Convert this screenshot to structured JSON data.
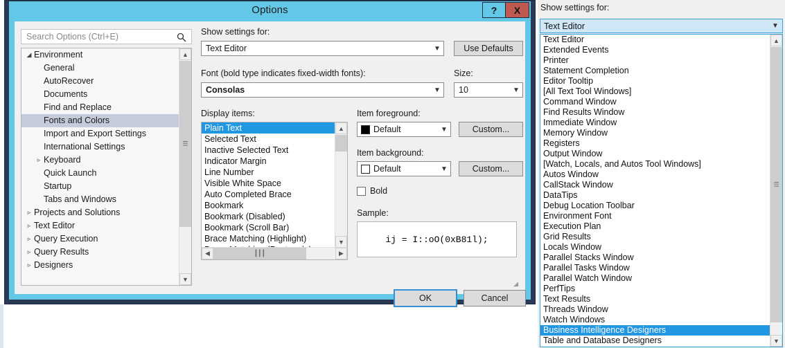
{
  "dialog": {
    "title": "Options",
    "help_button": "?",
    "close_button": "X",
    "search": {
      "placeholder": "Search Options (Ctrl+E)",
      "icon": "search-icon"
    },
    "tree": [
      {
        "label": "Environment",
        "level": 0,
        "expander": "expanded",
        "selected": false
      },
      {
        "label": "General",
        "level": 1,
        "expander": "none",
        "selected": false
      },
      {
        "label": "AutoRecover",
        "level": 1,
        "expander": "none",
        "selected": false
      },
      {
        "label": "Documents",
        "level": 1,
        "expander": "none",
        "selected": false
      },
      {
        "label": "Find and Replace",
        "level": 1,
        "expander": "none",
        "selected": false
      },
      {
        "label": "Fonts and Colors",
        "level": 1,
        "expander": "none",
        "selected": true
      },
      {
        "label": "Import and Export Settings",
        "level": 1,
        "expander": "none",
        "selected": false
      },
      {
        "label": "International Settings",
        "level": 1,
        "expander": "none",
        "selected": false
      },
      {
        "label": "Keyboard",
        "level": 1,
        "expander": "collapsed",
        "selected": false
      },
      {
        "label": "Quick Launch",
        "level": 1,
        "expander": "none",
        "selected": false
      },
      {
        "label": "Startup",
        "level": 1,
        "expander": "none",
        "selected": false
      },
      {
        "label": "Tabs and Windows",
        "level": 1,
        "expander": "none",
        "selected": false
      },
      {
        "label": "Projects and Solutions",
        "level": 0,
        "expander": "collapsed",
        "selected": false
      },
      {
        "label": "Text Editor",
        "level": 0,
        "expander": "collapsed",
        "selected": false
      },
      {
        "label": "Query Execution",
        "level": 0,
        "expander": "collapsed",
        "selected": false
      },
      {
        "label": "Query Results",
        "level": 0,
        "expander": "collapsed",
        "selected": false
      },
      {
        "label": "Designers",
        "level": 0,
        "expander": "collapsed",
        "selected": false
      }
    ],
    "show_settings_label": "Show settings for:",
    "show_settings_value": "Text Editor",
    "use_defaults_label": "Use Defaults",
    "font_label": "Font (bold type indicates fixed-width fonts):",
    "font_value": "Consolas",
    "size_label": "Size:",
    "size_value": "10",
    "display_items_label": "Display items:",
    "display_items": [
      "Plain Text",
      "Selected Text",
      "Inactive Selected Text",
      "Indicator Margin",
      "Line Number",
      "Visible White Space",
      "Auto Completed Brace",
      "Bookmark",
      "Bookmark (Disabled)",
      "Bookmark (Scroll Bar)",
      "Brace Matching (Highlight)",
      "Brace Matching (Rectangle)"
    ],
    "display_items_selected": "Plain Text",
    "item_foreground_label": "Item foreground:",
    "item_foreground_value": "Default",
    "item_foreground_swatch": "#000000",
    "item_foreground_custom": "Custom...",
    "item_background_label": "Item background:",
    "item_background_value": "Default",
    "item_background_swatch": "#ffffff",
    "item_background_custom": "Custom...",
    "bold_label": "Bold",
    "bold_checked": false,
    "sample_label": "Sample:",
    "sample_text": "ij = I::oO(0xB81l);",
    "ok_label": "OK",
    "cancel_label": "Cancel"
  },
  "right_panel": {
    "label": "Show settings for:",
    "selected_value": "Text Editor",
    "items": [
      {
        "label": "Text Editor",
        "selected": false
      },
      {
        "label": "Extended Events",
        "selected": false
      },
      {
        "label": "Printer",
        "selected": false
      },
      {
        "label": "Statement Completion",
        "selected": false
      },
      {
        "label": "Editor Tooltip",
        "selected": false
      },
      {
        "label": "[All Text Tool Windows]",
        "selected": false
      },
      {
        "label": "Command Window",
        "selected": false
      },
      {
        "label": "Find Results Window",
        "selected": false
      },
      {
        "label": "Immediate Window",
        "selected": false
      },
      {
        "label": "Memory Window",
        "selected": false
      },
      {
        "label": "Registers",
        "selected": false
      },
      {
        "label": "Output Window",
        "selected": false
      },
      {
        "label": "[Watch, Locals, and Autos Tool Windows]",
        "selected": false
      },
      {
        "label": "Autos Window",
        "selected": false
      },
      {
        "label": "CallStack Window",
        "selected": false
      },
      {
        "label": "DataTips",
        "selected": false
      },
      {
        "label": "Debug Location Toolbar",
        "selected": false
      },
      {
        "label": "Environment Font",
        "selected": false
      },
      {
        "label": "Execution Plan",
        "selected": false
      },
      {
        "label": "Grid Results",
        "selected": false
      },
      {
        "label": "Locals Window",
        "selected": false
      },
      {
        "label": "Parallel Stacks Window",
        "selected": false
      },
      {
        "label": "Parallel Tasks Window",
        "selected": false
      },
      {
        "label": "Parallel Watch Window",
        "selected": false
      },
      {
        "label": "PerfTips",
        "selected": false
      },
      {
        "label": "Text Results",
        "selected": false
      },
      {
        "label": "Threads Window",
        "selected": false
      },
      {
        "label": "Watch Windows",
        "selected": false
      },
      {
        "label": "Business Intelligence Designers",
        "selected": true
      },
      {
        "label": "Table and Database Designers",
        "selected": false
      }
    ]
  },
  "colors": {
    "title_bar": "#63c8e8",
    "frame": "#2b3a54",
    "close_button": "#c05a51",
    "selection_blue": "#2196e3",
    "tree_selection": "#c5cbdb",
    "dialog_bg": "#f0f0f0"
  }
}
